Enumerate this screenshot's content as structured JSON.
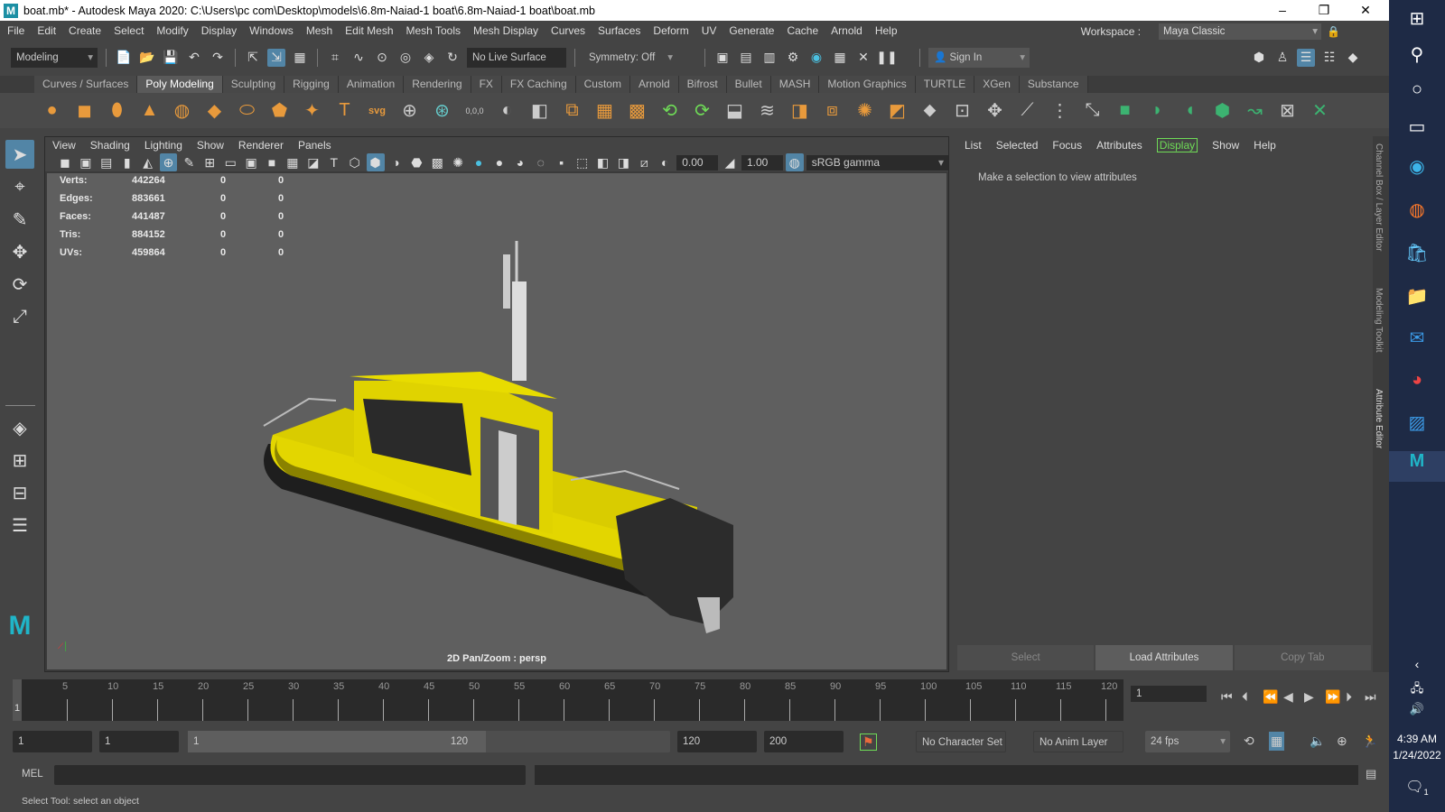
{
  "title": "boat.mb* - Autodesk Maya 2020: C:\\Users\\pc com\\Desktop\\models\\6.8m-Naiad-1 boat\\6.8m-Naiad-1 boat\\boat.mb",
  "app_logo": "M",
  "window_controls": {
    "minimize": "–",
    "restore": "❐",
    "close": "✕"
  },
  "menu": [
    "File",
    "Edit",
    "Create",
    "Select",
    "Modify",
    "Display",
    "Windows",
    "Mesh",
    "Edit Mesh",
    "Mesh Tools",
    "Mesh Display",
    "Curves",
    "Surfaces",
    "Deform",
    "UV",
    "Generate",
    "Cache",
    "Arnold",
    "Help"
  ],
  "workspace": {
    "label": "Workspace :",
    "value": "Maya Classic"
  },
  "status_line": {
    "menu_set": "Modeling",
    "live_surface": "No Live Surface",
    "symmetry": "Symmetry: Off",
    "sign_in": "Sign In"
  },
  "shelf_tabs": [
    "Curves / Surfaces",
    "Poly Modeling",
    "Sculpting",
    "Rigging",
    "Animation",
    "Rendering",
    "FX",
    "FX Caching",
    "Custom",
    "Arnold",
    "Bifrost",
    "Bullet",
    "MASH",
    "Motion Graphics",
    "TURTLE",
    "XGen",
    "Substance"
  ],
  "active_shelf": "Poly Modeling",
  "shelf_svg_label": "svg",
  "shelf_coord_label": "0,0,0",
  "viewport": {
    "menu": [
      "View",
      "Shading",
      "Lighting",
      "Show",
      "Renderer",
      "Panels"
    ],
    "exposure": "0.00",
    "gamma": "1.00",
    "color_space": "sRGB gamma",
    "hud": [
      {
        "label": "Verts:",
        "a": "442264",
        "b": "0",
        "c": "0"
      },
      {
        "label": "Edges:",
        "a": "883661",
        "b": "0",
        "c": "0"
      },
      {
        "label": "Faces:",
        "a": "441487",
        "b": "0",
        "c": "0"
      },
      {
        "label": "Tris:",
        "a": "884152",
        "b": "0",
        "c": "0"
      },
      {
        "label": "UVs:",
        "a": "459864",
        "b": "0",
        "c": "0"
      }
    ],
    "camera_label": "2D Pan/Zoom : persp"
  },
  "attribute_editor": {
    "menu": [
      "List",
      "Selected",
      "Focus",
      "Attributes",
      "Display",
      "Show",
      "Help"
    ],
    "message": "Make a selection to view attributes",
    "buttons": {
      "select": "Select",
      "load": "Load Attributes",
      "copy": "Copy Tab"
    }
  },
  "side_tabs": [
    "Channel Box / Layer Editor",
    "Modeling Toolkit",
    "Attribute Editor"
  ],
  "timeline": {
    "ticks": [
      5,
      10,
      15,
      20,
      25,
      30,
      35,
      40,
      45,
      50,
      55,
      60,
      65,
      70,
      75,
      80,
      85,
      90,
      95,
      100,
      105,
      110,
      115,
      120
    ],
    "current_frame_marker": "1",
    "current_frame": "1"
  },
  "range": {
    "start": "1",
    "playback_start": "1",
    "slider_start": "1",
    "slider_end": "120",
    "playback_end": "120",
    "end": "200",
    "character_set": "No Character Set",
    "anim_layer": "No Anim Layer",
    "fps": "24 fps"
  },
  "command_line": {
    "label": "MEL"
  },
  "help_line": "Select Tool: select an object",
  "taskbar": {
    "time": "4:39 AM",
    "date": "1/24/2022",
    "notifications": "1"
  },
  "colors": {
    "accent": "#5285a6",
    "hull": "#e6d900",
    "highlight": "#6fdc57"
  }
}
